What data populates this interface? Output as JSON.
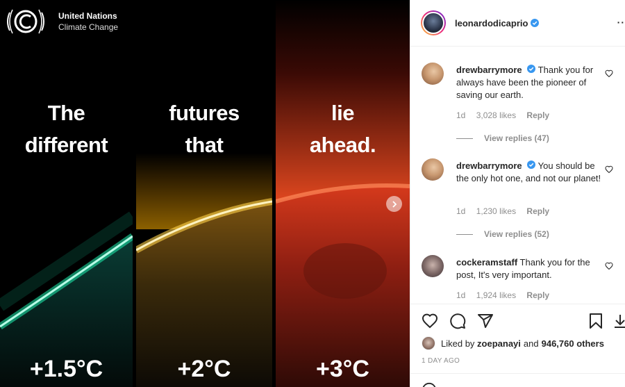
{
  "media": {
    "org": {
      "line1": "United Nations",
      "line2": "Climate Change"
    },
    "panels": [
      {
        "line1": "The",
        "line2": "different",
        "temp": "+1.5°C",
        "color": "#19d8a0"
      },
      {
        "line1": "futures",
        "line2": "that",
        "temp": "+2°C",
        "color": "#f2a81c"
      },
      {
        "line1": "lie",
        "line2": "ahead.",
        "temp": "+3°C",
        "color": "#e8391f"
      }
    ]
  },
  "post": {
    "owner": "leonardodicaprio",
    "comments": [
      {
        "user": "drewbarrymore",
        "text": "Thank you for always have been the pioneer of saving our earth.",
        "age": "1d",
        "likes": "3,028 likes",
        "reply": "Reply",
        "view_replies": "View replies (47)"
      },
      {
        "user": "drewbarrymore",
        "text": "You should be the only hot one, and not our planet!",
        "age": "1d",
        "likes": "1,230 likes",
        "reply": "Reply",
        "view_replies": "View replies (52)"
      },
      {
        "user": "cockeramstaff",
        "text": "Thank you for the post, It's very important.",
        "age": "1d",
        "likes": "1,924 likes",
        "reply": "Reply"
      }
    ],
    "liked_by": {
      "prefix": "Liked by",
      "user": "zoepanayi",
      "mid": "and",
      "others": "946,760 others"
    },
    "time_ago": "1 DAY AGO"
  },
  "colors": {
    "verified": "#3897f0",
    "text": "#262626",
    "muted": "#8e8e8e"
  }
}
